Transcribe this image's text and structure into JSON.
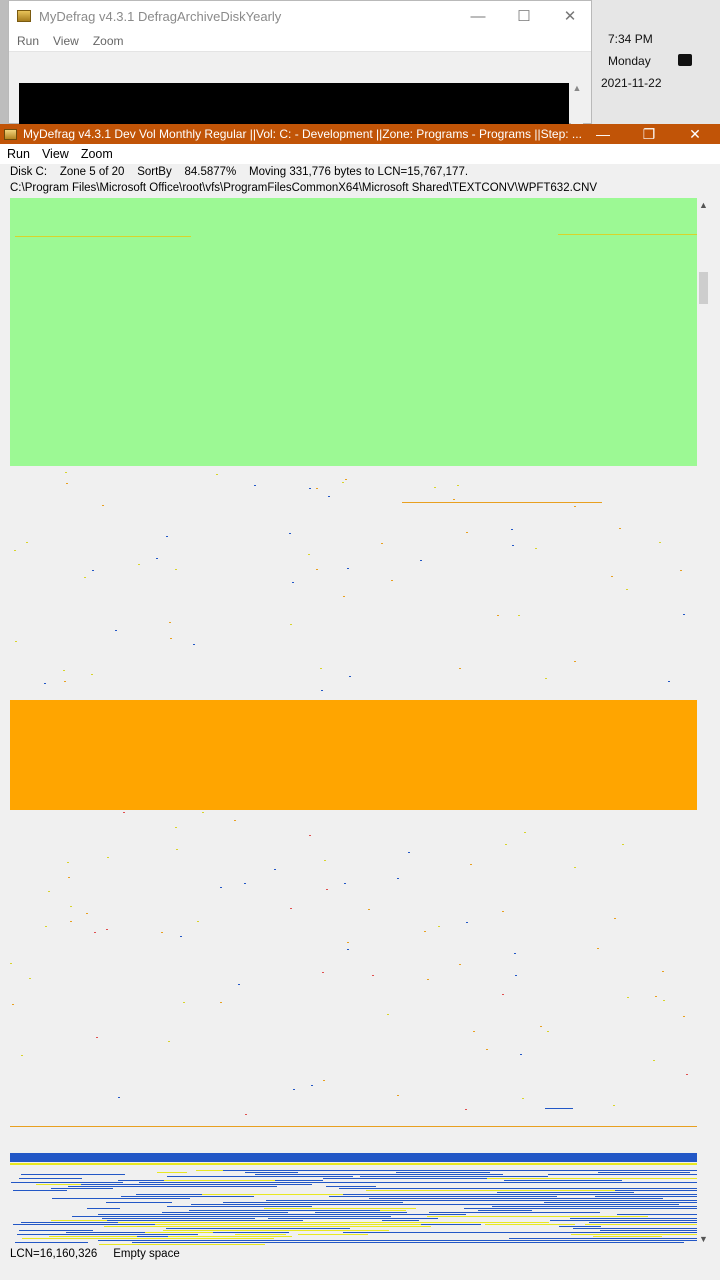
{
  "background_window": {
    "title": "MyDefrag v4.3.1    DefragArchiveDiskYearly",
    "menu": [
      "Run",
      "View",
      "Zoom"
    ],
    "controls": {
      "minimize": "—",
      "maximize": "☐",
      "close": "✕"
    }
  },
  "clock": {
    "time": "7:34 PM",
    "day": "Monday",
    "date": "2021-11-22"
  },
  "main_window": {
    "title": "MyDefrag v4.3.1    Dev Vol Monthly Regular ||Vol: C: - Development ||Zone: Programs - Programs ||Step: ...",
    "controls": {
      "minimize": "—",
      "restore": "❐",
      "close": "✕"
    },
    "menu": [
      "Run",
      "View",
      "Zoom"
    ],
    "status_line1": "Disk C:    Zone 5 of 20    SortBy    84.5877%    Moving 331,776 bytes to LCN=15,767,177.",
    "status_line2": "C:\\Program Files\\Microsoft Office\\root\\vfs\\ProgramFilesCommonX64\\Microsoft Shared\\TEXTCONV\\WPFT632.CNV",
    "bottom_status": "LCN=16,160,326     Empty space"
  },
  "colors": {
    "titlebar_active": "#c15407",
    "zone_green": "#9cf994",
    "zone_orange": "#ffa500",
    "empty_space": "#f0f0f0",
    "file_blue": "#2257c6",
    "file_yellow": "#e8e822"
  }
}
